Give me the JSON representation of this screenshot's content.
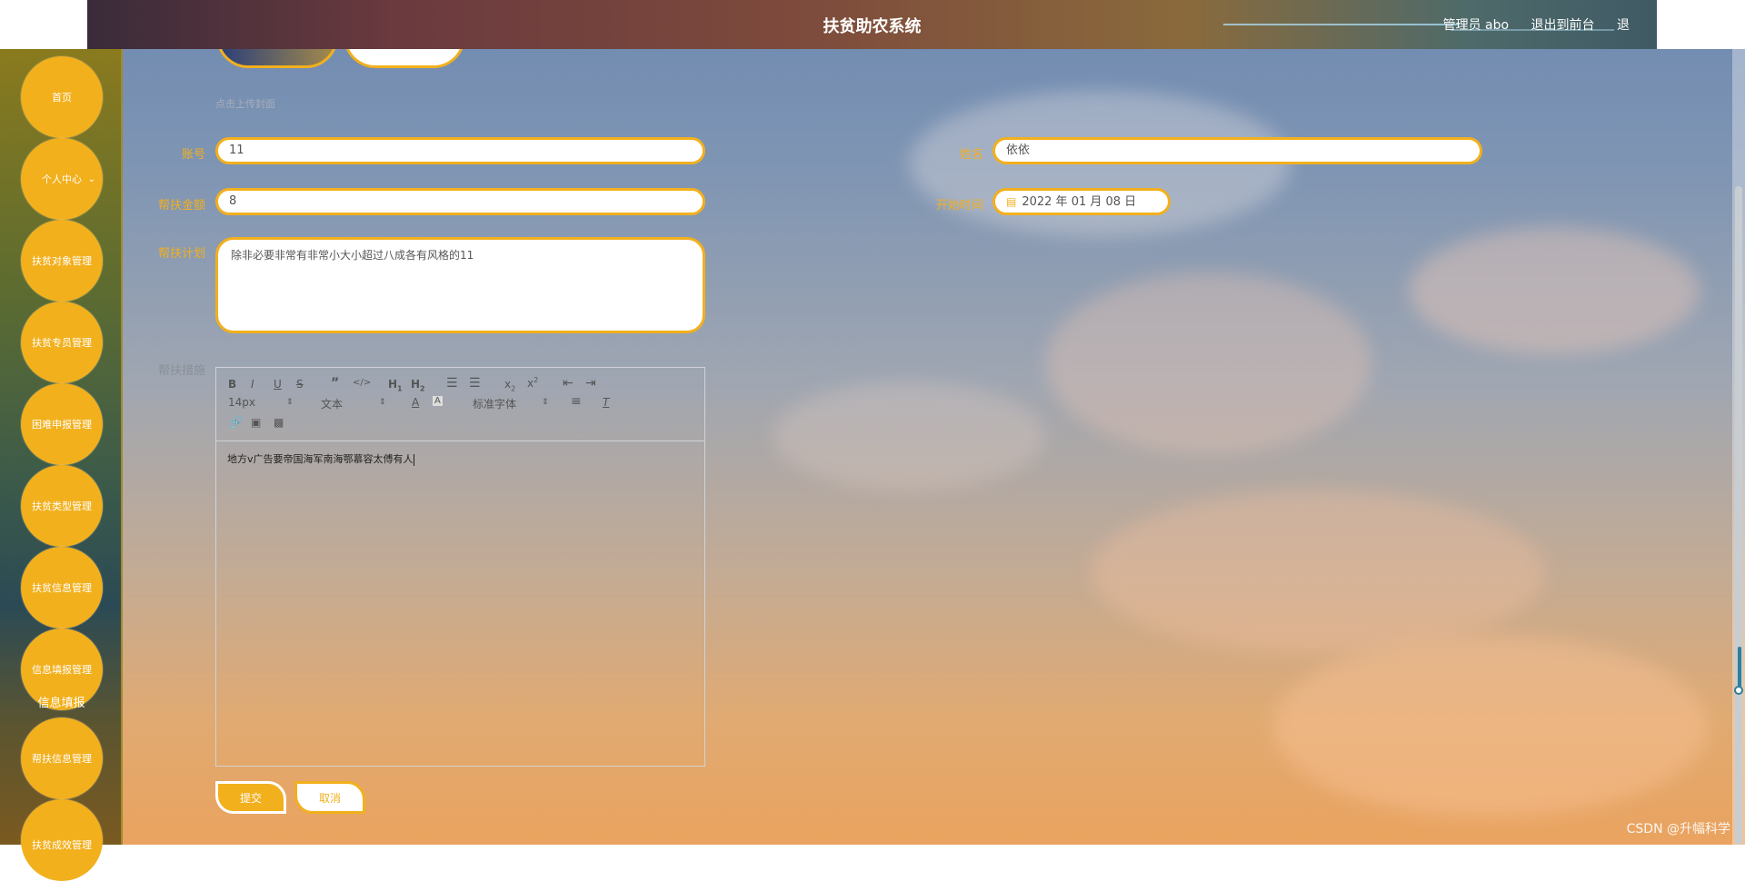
{
  "header": {
    "title": "扶贫助农系统",
    "admin_label": "管理员 abo",
    "front_link": "退出到前台",
    "cut_char": "退"
  },
  "sidebar": {
    "items": [
      {
        "label": "首页"
      },
      {
        "label": "个人中心"
      },
      {
        "label": "扶贫对象管理"
      },
      {
        "label": "扶贫专员管理"
      },
      {
        "label": "困难申报管理"
      },
      {
        "label": "扶贫类型管理"
      },
      {
        "label": "扶贫信息管理"
      },
      {
        "label": "信息填报管理"
      },
      {
        "label": "帮扶信息管理"
      },
      {
        "label": "扶贫成效管理"
      }
    ],
    "submenu_label": "信息填报",
    "chevron": "⌄"
  },
  "form": {
    "upload_hint": "点击上传封面",
    "account_label": "账号",
    "account_value": "11",
    "name_label": "姓名",
    "name_value": "依依",
    "amount_label": "帮扶金额",
    "amount_value": "8",
    "start_time_label": "开始时间",
    "start_time_value": "2022 年 01 月 08 日",
    "plan_label": "帮扶计划",
    "plan_value": "除非必要非常有非常小大小超过八成各有风格的11",
    "measures_label": "帮扶措施",
    "editor": {
      "font_size": "14px",
      "block_type": "文本",
      "font_family": "标准字体",
      "content": "地方v广告要帝国海军南海鄂慕容太傅有人"
    },
    "submit_label": "提交",
    "cancel_label": "取消"
  },
  "watermark": "CSDN @升幅科学",
  "colors": {
    "accent": "#f2b01d",
    "header_dark": "#3a2b3a",
    "white": "#ffffff"
  },
  "icons": [
    "calendar-icon",
    "bold-icon",
    "italic-icon",
    "underline-icon",
    "strike-icon",
    "quote-icon",
    "code-icon",
    "h1-icon",
    "h2-icon",
    "ordered-list-icon",
    "bullet-list-icon",
    "subscript-icon",
    "superscript-icon",
    "outdent-icon",
    "indent-icon",
    "font-color-icon",
    "background-color-icon",
    "align-icon",
    "clear-format-icon",
    "link-icon",
    "image-icon",
    "video-icon",
    "chevron-down-icon"
  ]
}
